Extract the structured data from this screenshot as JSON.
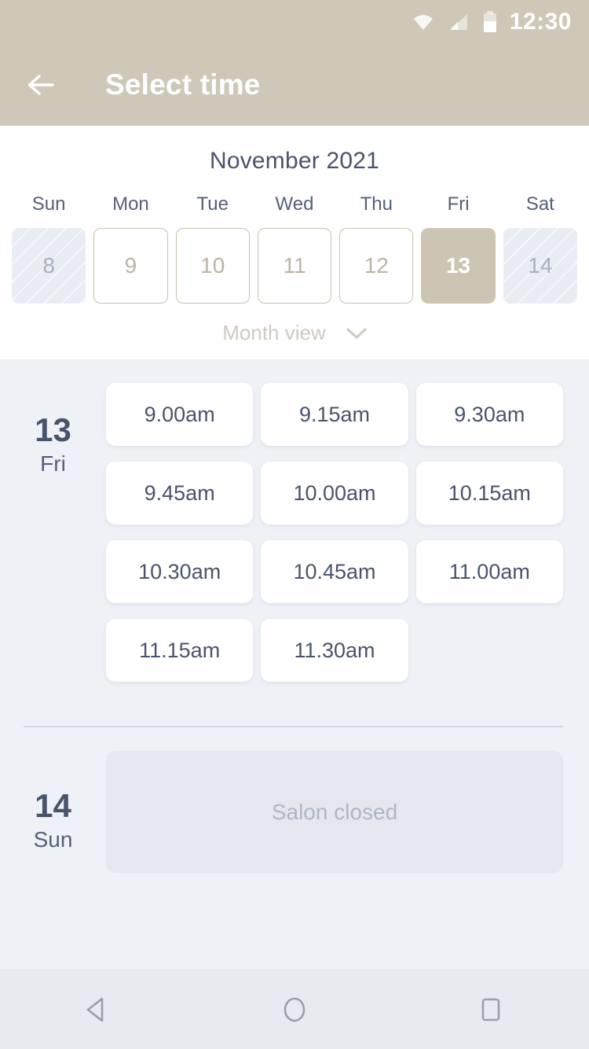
{
  "statusbar": {
    "time": "12:30",
    "icons": [
      "wifi-icon",
      "cellular-signal-icon",
      "battery-icon"
    ]
  },
  "appbar": {
    "back_icon": "back-arrow-icon",
    "title": "Select time"
  },
  "calendar": {
    "month_label": "November 2021",
    "weekdays": [
      "Sun",
      "Mon",
      "Tue",
      "Wed",
      "Thu",
      "Fri",
      "Sat"
    ],
    "days": [
      {
        "num": "8",
        "state": "disabled"
      },
      {
        "num": "9",
        "state": "available"
      },
      {
        "num": "10",
        "state": "available"
      },
      {
        "num": "11",
        "state": "available"
      },
      {
        "num": "12",
        "state": "available"
      },
      {
        "num": "13",
        "state": "selected"
      },
      {
        "num": "14",
        "state": "disabled"
      }
    ],
    "view_toggle_label": "Month view",
    "view_toggle_icon": "chevron-down-icon"
  },
  "schedule": [
    {
      "day_number": "13",
      "day_of_week": "Fri",
      "slots": [
        "9.00am",
        "9.15am",
        "9.30am",
        "9.45am",
        "10.00am",
        "10.15am",
        "10.30am",
        "10.45am",
        "11.00am",
        "11.15am",
        "11.30am"
      ],
      "closed_message": null
    },
    {
      "day_number": "14",
      "day_of_week": "Sun",
      "slots": [],
      "closed_message": "Salon closed"
    }
  ],
  "navbar": {
    "back_label": "back-triangle-icon",
    "home_label": "home-circle-icon",
    "recents_label": "recents-square-icon"
  },
  "colors": {
    "appbar_bg": "#cfc8b9",
    "accent_selected": "#cdc5b4",
    "text_dark": "#49546b",
    "content_bg": "#eef1f6",
    "slot_bg": "#ffffff",
    "closed_bg": "#e4e8ee"
  }
}
